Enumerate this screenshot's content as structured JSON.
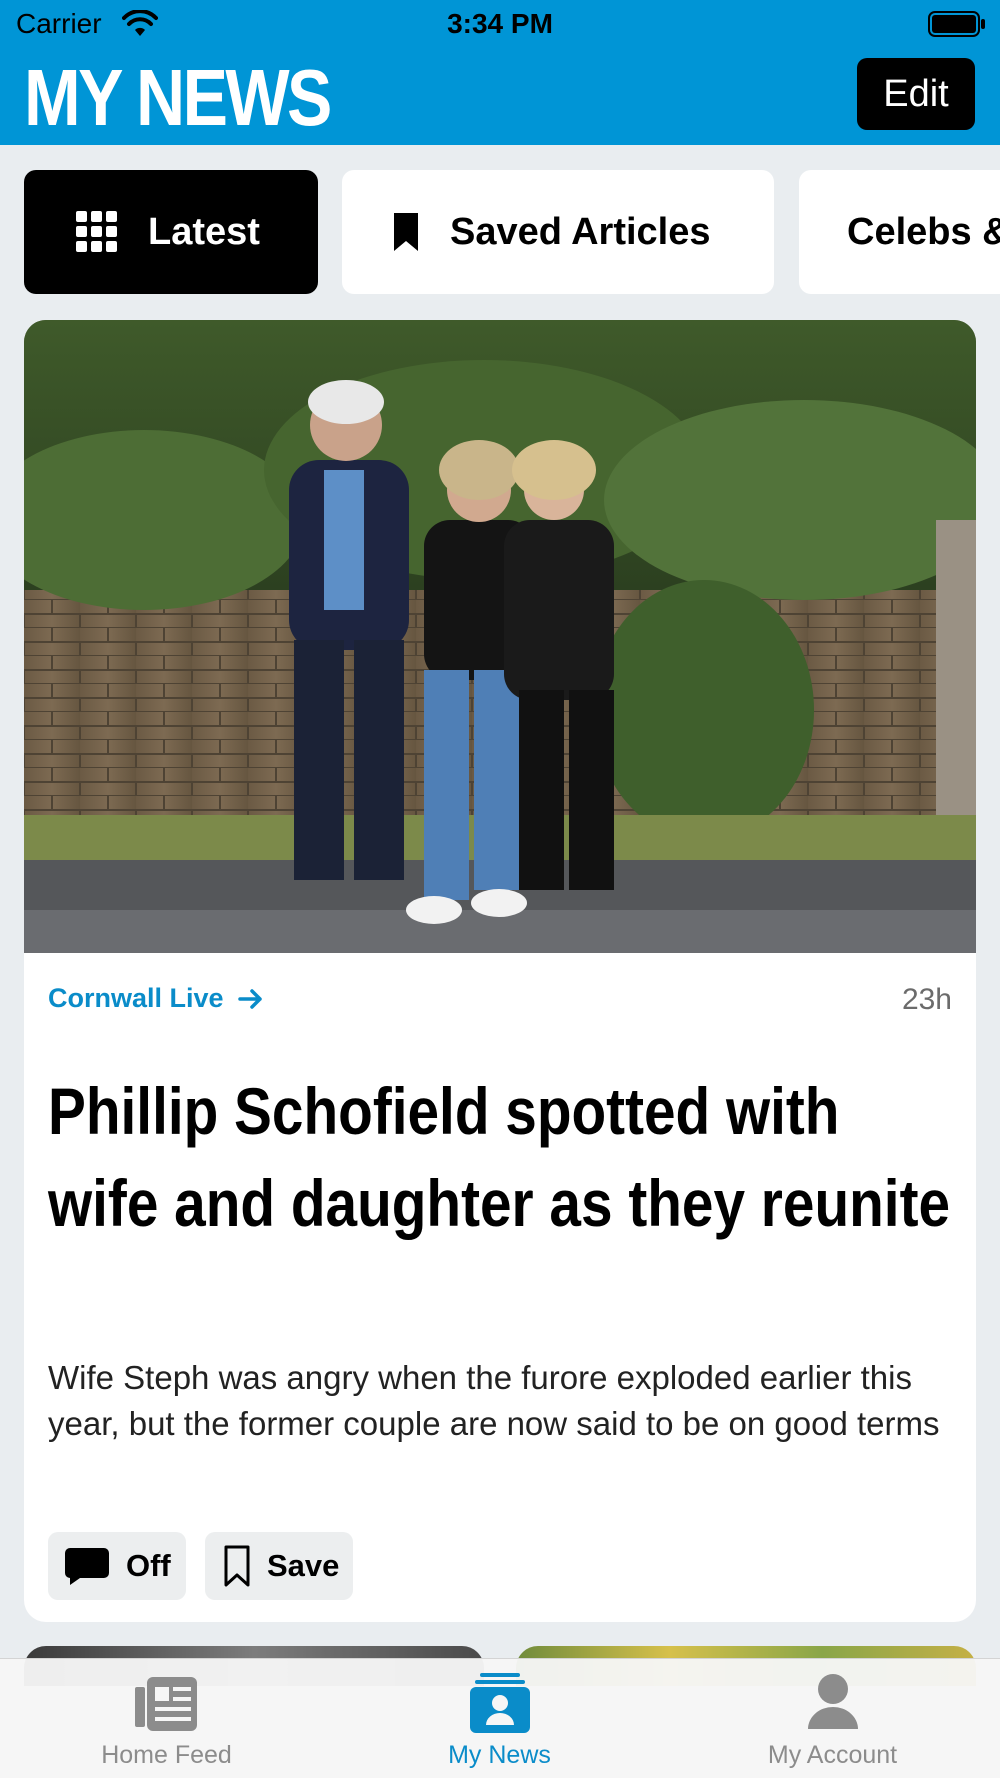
{
  "status_bar": {
    "carrier": "Carrier",
    "time": "3:34 PM"
  },
  "header": {
    "title": "MY NEWS",
    "edit_label": "Edit",
    "background_color": "#0095d6"
  },
  "tabs": [
    {
      "label": "Latest",
      "icon": "grid-icon",
      "active": true
    },
    {
      "label": "Saved Articles",
      "icon": "bookmark-icon",
      "active": false
    },
    {
      "label": "Celebs &",
      "icon": "",
      "active": false
    }
  ],
  "article": {
    "image": "photo of three people walking past a brick wall with ivy",
    "source": "Cornwall Live",
    "time_ago": "23h",
    "headline": "Phillip Schofield spotted with wife and daughter as they reunite",
    "summary": "Wife Steph was angry when the furore exploded earlier this year, but the former couple are now said to be on good terms",
    "comments_label": "Off",
    "save_label": "Save"
  },
  "tabbar": [
    {
      "label": "Home Feed",
      "icon": "home-feed-icon",
      "active": false
    },
    {
      "label": "My News",
      "icon": "my-news-icon",
      "active": true
    },
    {
      "label": "My Account",
      "icon": "account-icon",
      "active": false
    }
  ],
  "colors": {
    "accent": "#0a8cc9",
    "inactive": "#8c8c8c"
  }
}
